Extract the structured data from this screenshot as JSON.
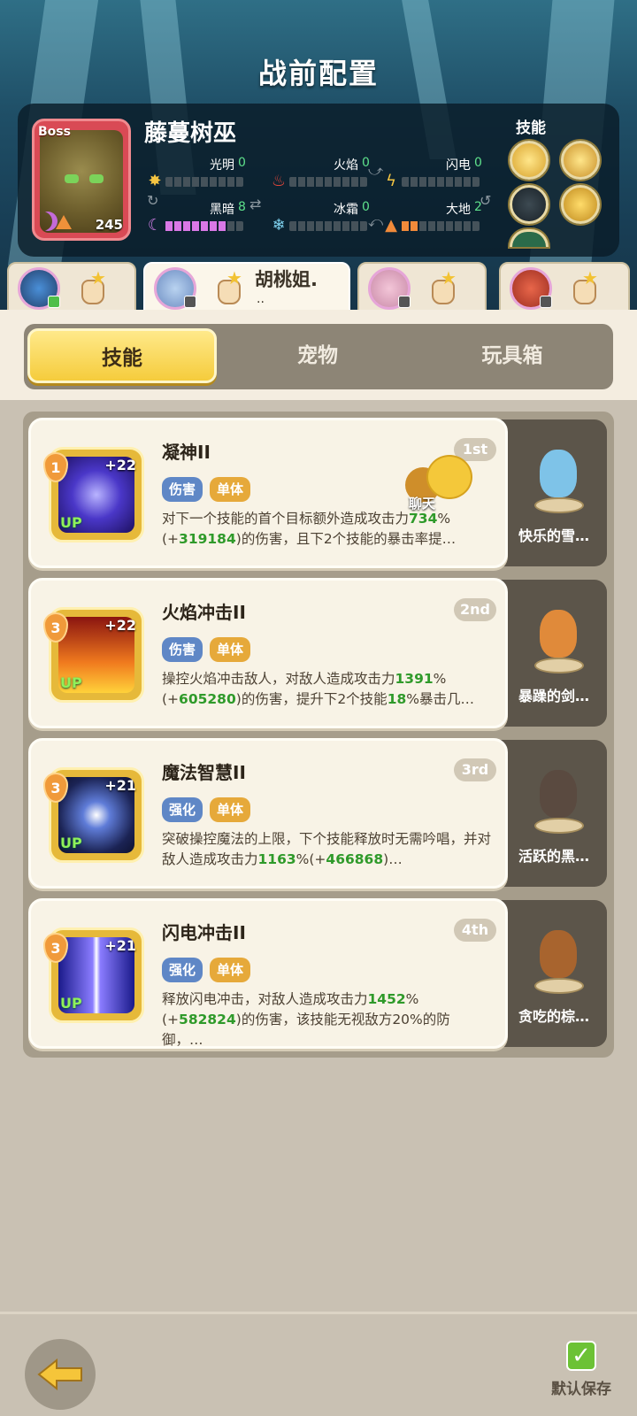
{
  "header": {
    "title": "战前配置"
  },
  "boss": {
    "tag": "Boss",
    "name": "藤蔓树巫",
    "level": "245",
    "elements": [
      {
        "name": "光明",
        "value": "0",
        "icon": "sun-icon",
        "fill": 0
      },
      {
        "name": "火焰",
        "value": "0",
        "icon": "flame-icon",
        "fill": 0
      },
      {
        "name": "闪电",
        "value": "0",
        "icon": "lightning-icon",
        "fill": 0
      },
      {
        "name": "黑暗",
        "value": "8",
        "icon": "moon-icon",
        "fill": 0.8
      },
      {
        "name": "冰霜",
        "value": "0",
        "icon": "snowflake-icon",
        "fill": 0
      },
      {
        "name": "大地",
        "value": "2",
        "icon": "earth-icon",
        "fill": 0.2
      }
    ],
    "skills_label": "技能"
  },
  "characters": [
    {
      "name": "",
      "active": false
    },
    {
      "name": "胡桃姐.",
      "dots": "..",
      "active": true
    },
    {
      "name": "",
      "active": false
    },
    {
      "name": "",
      "active": false
    }
  ],
  "tabs": [
    {
      "label": "技能",
      "active": true
    },
    {
      "label": "宠物",
      "active": false
    },
    {
      "label": "玩具箱",
      "active": false
    }
  ],
  "skills": [
    {
      "title": "凝神II",
      "rank": "1st",
      "level": "1",
      "plus": "+22",
      "up": "UP",
      "tags": [
        "伤害",
        "单体"
      ],
      "desc_parts": [
        {
          "t": "对下一个技能的首个目标额外造成攻击力",
          "g": false
        },
        {
          "t": "734",
          "g": true
        },
        {
          "t": "%(+",
          "g": false
        },
        {
          "t": "319184",
          "g": true
        },
        {
          "t": ")的伤害，且下2个技能的暴击率提…",
          "g": false
        }
      ],
      "pet": "快乐的雪…"
    },
    {
      "title": "火焰冲击II",
      "rank": "2nd",
      "level": "3",
      "plus": "+22",
      "up": "UP",
      "tags": [
        "伤害",
        "单体"
      ],
      "desc_parts": [
        {
          "t": "操控火焰冲击敌人，对敌人造成攻击力",
          "g": false
        },
        {
          "t": "1391",
          "g": true
        },
        {
          "t": "%(+",
          "g": false
        },
        {
          "t": "605280",
          "g": true
        },
        {
          "t": ")的伤害，提升下2个技能",
          "g": false
        },
        {
          "t": "18",
          "g": true
        },
        {
          "t": "%暴击几…",
          "g": false
        }
      ],
      "pet": "暴躁的剑…"
    },
    {
      "title": "魔法智慧II",
      "rank": "3rd",
      "level": "3",
      "plus": "+21",
      "up": "UP",
      "tags": [
        "强化",
        "单体"
      ],
      "desc_parts": [
        {
          "t": "突破操控魔法的上限，下个技能释放时无需吟唱，并对敌人造成攻击力",
          "g": false
        },
        {
          "t": "1163",
          "g": true
        },
        {
          "t": "%(+",
          "g": false
        },
        {
          "t": "466868",
          "g": true
        },
        {
          "t": ")…",
          "g": false
        }
      ],
      "pet": "活跃的黑…"
    },
    {
      "title": "闪电冲击II",
      "rank": "4th",
      "level": "3",
      "plus": "+21",
      "up": "UP",
      "tags": [
        "强化",
        "单体"
      ],
      "desc_parts": [
        {
          "t": "释放闪电冲击，对敌人造成攻击力",
          "g": false
        },
        {
          "t": "1452",
          "g": true
        },
        {
          "t": "%(+",
          "g": false
        },
        {
          "t": "582824",
          "g": true
        },
        {
          "t": ")的伤害，该技能无视敌方20%的防御，…",
          "g": false
        }
      ],
      "pet": "贪吃的棕…"
    }
  ],
  "chat": {
    "label": "聊天"
  },
  "footer": {
    "save_label": "默认保存"
  },
  "colors": {
    "accent_yellow": "#f5cc3c",
    "green_value": "#2f9a2a",
    "boss_red": "#d94a55"
  }
}
